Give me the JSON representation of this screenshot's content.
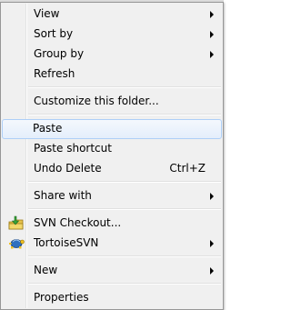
{
  "menu": {
    "items": [
      {
        "label": "View",
        "submenu": true
      },
      {
        "label": "Sort by",
        "submenu": true
      },
      {
        "label": "Group by",
        "submenu": true
      },
      {
        "label": "Refresh"
      },
      {
        "label": "Customize this folder..."
      },
      {
        "label": "Paste",
        "highlighted": true
      },
      {
        "label": "Paste shortcut"
      },
      {
        "label": "Undo Delete",
        "shortcut": "Ctrl+Z"
      },
      {
        "label": "Share with",
        "submenu": true
      },
      {
        "label": "SVN Checkout...",
        "icon": "svn-checkout-icon"
      },
      {
        "label": "TortoiseSVN",
        "icon": "tortoisesvn-icon",
        "submenu": true
      },
      {
        "label": "New",
        "submenu": true
      },
      {
        "label": "Properties"
      }
    ]
  },
  "colors": {
    "menu_background": "#f0f0f0",
    "highlight_border": "#aecff7",
    "highlight_fill": "#e4eefb"
  }
}
